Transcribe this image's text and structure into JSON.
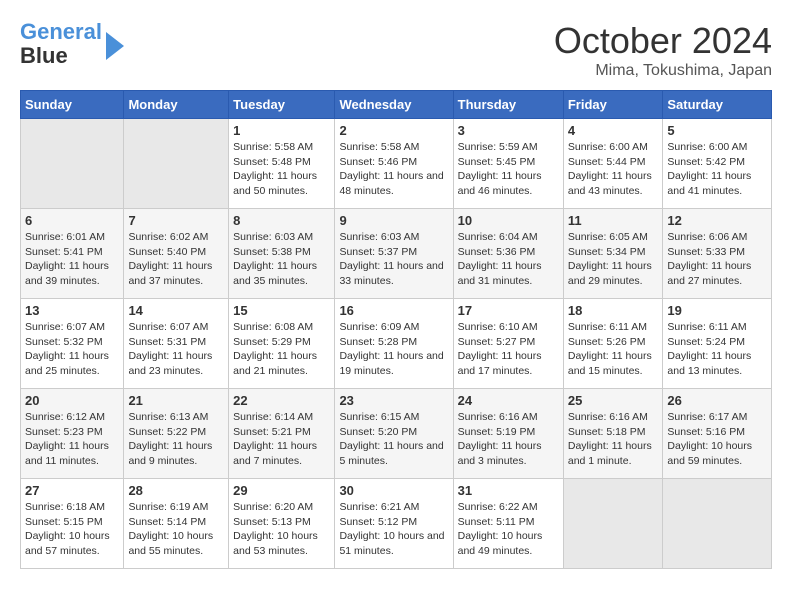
{
  "logo": {
    "line1": "General",
    "line2": "Blue"
  },
  "title": "October 2024",
  "location": "Mima, Tokushima, Japan",
  "weekdays": [
    "Sunday",
    "Monday",
    "Tuesday",
    "Wednesday",
    "Thursday",
    "Friday",
    "Saturday"
  ],
  "weeks": [
    [
      {
        "day": "",
        "sunrise": "",
        "sunset": "",
        "daylight": ""
      },
      {
        "day": "",
        "sunrise": "",
        "sunset": "",
        "daylight": ""
      },
      {
        "day": "1",
        "sunrise": "Sunrise: 5:58 AM",
        "sunset": "Sunset: 5:48 PM",
        "daylight": "Daylight: 11 hours and 50 minutes."
      },
      {
        "day": "2",
        "sunrise": "Sunrise: 5:58 AM",
        "sunset": "Sunset: 5:46 PM",
        "daylight": "Daylight: 11 hours and 48 minutes."
      },
      {
        "day": "3",
        "sunrise": "Sunrise: 5:59 AM",
        "sunset": "Sunset: 5:45 PM",
        "daylight": "Daylight: 11 hours and 46 minutes."
      },
      {
        "day": "4",
        "sunrise": "Sunrise: 6:00 AM",
        "sunset": "Sunset: 5:44 PM",
        "daylight": "Daylight: 11 hours and 43 minutes."
      },
      {
        "day": "5",
        "sunrise": "Sunrise: 6:00 AM",
        "sunset": "Sunset: 5:42 PM",
        "daylight": "Daylight: 11 hours and 41 minutes."
      }
    ],
    [
      {
        "day": "6",
        "sunrise": "Sunrise: 6:01 AM",
        "sunset": "Sunset: 5:41 PM",
        "daylight": "Daylight: 11 hours and 39 minutes."
      },
      {
        "day": "7",
        "sunrise": "Sunrise: 6:02 AM",
        "sunset": "Sunset: 5:40 PM",
        "daylight": "Daylight: 11 hours and 37 minutes."
      },
      {
        "day": "8",
        "sunrise": "Sunrise: 6:03 AM",
        "sunset": "Sunset: 5:38 PM",
        "daylight": "Daylight: 11 hours and 35 minutes."
      },
      {
        "day": "9",
        "sunrise": "Sunrise: 6:03 AM",
        "sunset": "Sunset: 5:37 PM",
        "daylight": "Daylight: 11 hours and 33 minutes."
      },
      {
        "day": "10",
        "sunrise": "Sunrise: 6:04 AM",
        "sunset": "Sunset: 5:36 PM",
        "daylight": "Daylight: 11 hours and 31 minutes."
      },
      {
        "day": "11",
        "sunrise": "Sunrise: 6:05 AM",
        "sunset": "Sunset: 5:34 PM",
        "daylight": "Daylight: 11 hours and 29 minutes."
      },
      {
        "day": "12",
        "sunrise": "Sunrise: 6:06 AM",
        "sunset": "Sunset: 5:33 PM",
        "daylight": "Daylight: 11 hours and 27 minutes."
      }
    ],
    [
      {
        "day": "13",
        "sunrise": "Sunrise: 6:07 AM",
        "sunset": "Sunset: 5:32 PM",
        "daylight": "Daylight: 11 hours and 25 minutes."
      },
      {
        "day": "14",
        "sunrise": "Sunrise: 6:07 AM",
        "sunset": "Sunset: 5:31 PM",
        "daylight": "Daylight: 11 hours and 23 minutes."
      },
      {
        "day": "15",
        "sunrise": "Sunrise: 6:08 AM",
        "sunset": "Sunset: 5:29 PM",
        "daylight": "Daylight: 11 hours and 21 minutes."
      },
      {
        "day": "16",
        "sunrise": "Sunrise: 6:09 AM",
        "sunset": "Sunset: 5:28 PM",
        "daylight": "Daylight: 11 hours and 19 minutes."
      },
      {
        "day": "17",
        "sunrise": "Sunrise: 6:10 AM",
        "sunset": "Sunset: 5:27 PM",
        "daylight": "Daylight: 11 hours and 17 minutes."
      },
      {
        "day": "18",
        "sunrise": "Sunrise: 6:11 AM",
        "sunset": "Sunset: 5:26 PM",
        "daylight": "Daylight: 11 hours and 15 minutes."
      },
      {
        "day": "19",
        "sunrise": "Sunrise: 6:11 AM",
        "sunset": "Sunset: 5:24 PM",
        "daylight": "Daylight: 11 hours and 13 minutes."
      }
    ],
    [
      {
        "day": "20",
        "sunrise": "Sunrise: 6:12 AM",
        "sunset": "Sunset: 5:23 PM",
        "daylight": "Daylight: 11 hours and 11 minutes."
      },
      {
        "day": "21",
        "sunrise": "Sunrise: 6:13 AM",
        "sunset": "Sunset: 5:22 PM",
        "daylight": "Daylight: 11 hours and 9 minutes."
      },
      {
        "day": "22",
        "sunrise": "Sunrise: 6:14 AM",
        "sunset": "Sunset: 5:21 PM",
        "daylight": "Daylight: 11 hours and 7 minutes."
      },
      {
        "day": "23",
        "sunrise": "Sunrise: 6:15 AM",
        "sunset": "Sunset: 5:20 PM",
        "daylight": "Daylight: 11 hours and 5 minutes."
      },
      {
        "day": "24",
        "sunrise": "Sunrise: 6:16 AM",
        "sunset": "Sunset: 5:19 PM",
        "daylight": "Daylight: 11 hours and 3 minutes."
      },
      {
        "day": "25",
        "sunrise": "Sunrise: 6:16 AM",
        "sunset": "Sunset: 5:18 PM",
        "daylight": "Daylight: 11 hours and 1 minute."
      },
      {
        "day": "26",
        "sunrise": "Sunrise: 6:17 AM",
        "sunset": "Sunset: 5:16 PM",
        "daylight": "Daylight: 10 hours and 59 minutes."
      }
    ],
    [
      {
        "day": "27",
        "sunrise": "Sunrise: 6:18 AM",
        "sunset": "Sunset: 5:15 PM",
        "daylight": "Daylight: 10 hours and 57 minutes."
      },
      {
        "day": "28",
        "sunrise": "Sunrise: 6:19 AM",
        "sunset": "Sunset: 5:14 PM",
        "daylight": "Daylight: 10 hours and 55 minutes."
      },
      {
        "day": "29",
        "sunrise": "Sunrise: 6:20 AM",
        "sunset": "Sunset: 5:13 PM",
        "daylight": "Daylight: 10 hours and 53 minutes."
      },
      {
        "day": "30",
        "sunrise": "Sunrise: 6:21 AM",
        "sunset": "Sunset: 5:12 PM",
        "daylight": "Daylight: 10 hours and 51 minutes."
      },
      {
        "day": "31",
        "sunrise": "Sunrise: 6:22 AM",
        "sunset": "Sunset: 5:11 PM",
        "daylight": "Daylight: 10 hours and 49 minutes."
      },
      {
        "day": "",
        "sunrise": "",
        "sunset": "",
        "daylight": ""
      },
      {
        "day": "",
        "sunrise": "",
        "sunset": "",
        "daylight": ""
      }
    ]
  ]
}
